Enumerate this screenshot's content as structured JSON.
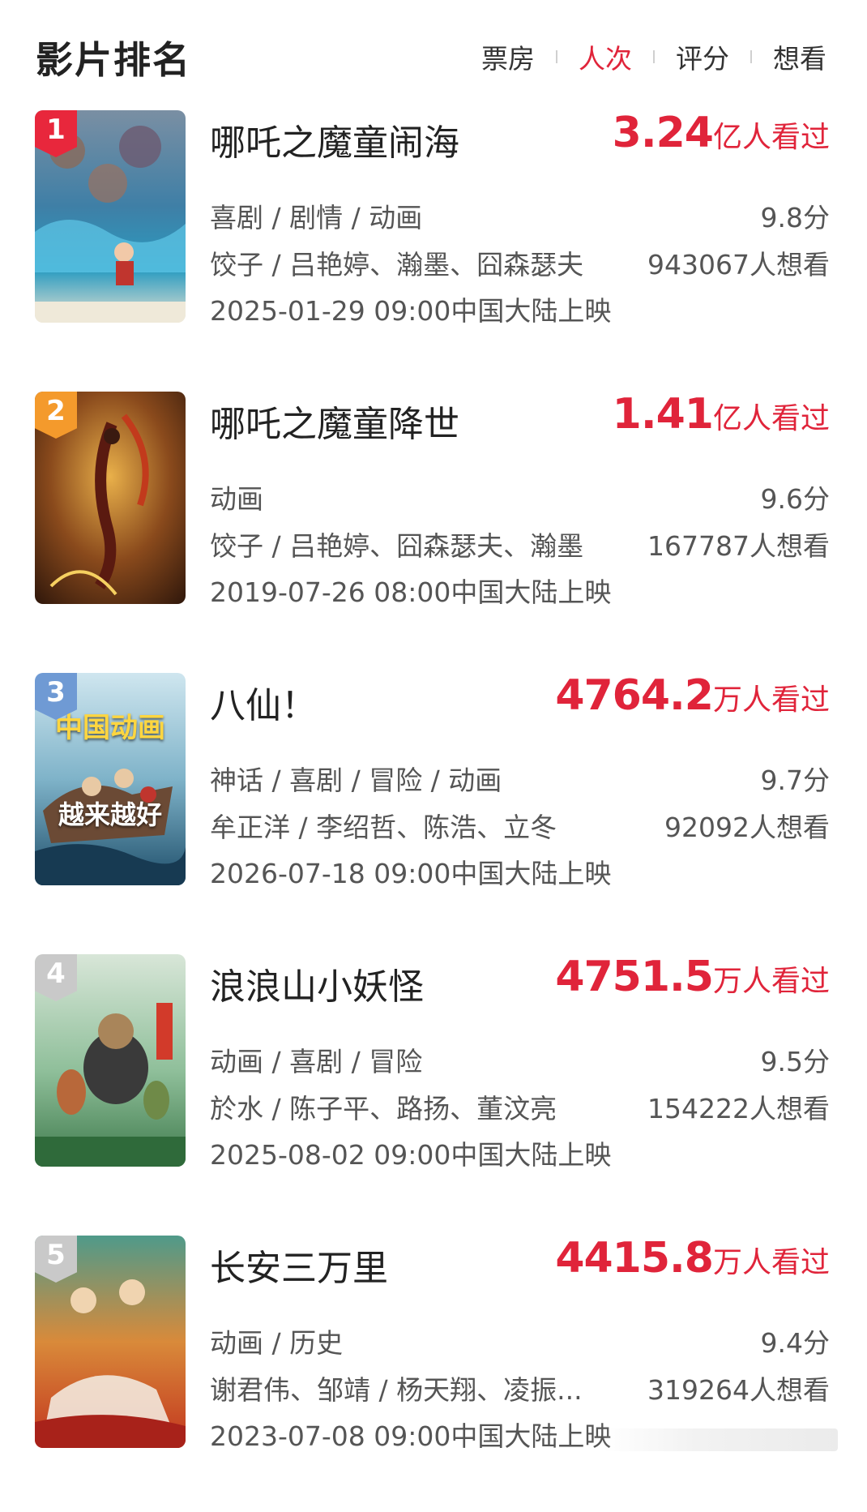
{
  "header": {
    "title": "影片排名",
    "tabs": [
      {
        "label": "票房",
        "active": false
      },
      {
        "label": "人次",
        "active": true
      },
      {
        "label": "评分",
        "active": false
      },
      {
        "label": "想看",
        "active": false
      }
    ]
  },
  "colors": {
    "accent": "#e0243a",
    "rank1": "#e8273c",
    "rank2": "#f49a2c",
    "rank3": "#6f9ad4",
    "rank_other": "#c9c9c9"
  },
  "movies": [
    {
      "rank": "1",
      "title": "哪吒之魔童闹海",
      "views_num": "3.24",
      "views_unit": "亿人看过",
      "genres": "喜剧 / 剧情 / 动画",
      "rating": "9.8分",
      "people": "饺子 / 吕艳婷、瀚墨、囧森瑟夫",
      "wants": "943067人想看",
      "release": "2025-01-29 09:00中国大陆上映",
      "poster_icon": "nezha-poster-image"
    },
    {
      "rank": "2",
      "title": "哪吒之魔童降世",
      "views_num": "1.41",
      "views_unit": "亿人看过",
      "genres": "动画",
      "rating": "9.6分",
      "people": "饺子 / 吕艳婷、囧森瑟夫、瀚墨",
      "wants": "167787人想看",
      "release": "2019-07-26 08:00中国大陆上映",
      "poster_icon": "nezha-poster-image"
    },
    {
      "rank": "3",
      "title": "八仙！",
      "views_num": "4764.2",
      "views_unit": "万人看过",
      "genres": "神话 / 喜剧 / 冒险 / 动画",
      "rating": "9.7分",
      "people": "牟正洋 / 李绍哲、陈浩、立冬",
      "wants": "92092人想看",
      "release": "2026-07-18 09:00中国大陆上映",
      "poster_text_1": "中国动画",
      "poster_text_2": "越来越好",
      "poster_icon": "baxian-poster-image"
    },
    {
      "rank": "4",
      "title": "浪浪山小妖怪",
      "views_num": "4751.5",
      "views_unit": "万人看过",
      "genres": "动画 / 喜剧 / 冒险",
      "rating": "9.5分",
      "people": "於水 / 陈子平、路扬、董汶亮",
      "wants": "154222人想看",
      "release": "2025-08-02 09:00中国大陆上映",
      "poster_icon": "langlangshan-poster-image"
    },
    {
      "rank": "5",
      "title": "长安三万里",
      "views_num": "4415.8",
      "views_unit": "万人看过",
      "genres": "动画 / 历史",
      "rating": "9.4分",
      "people": "谢君伟、邹靖 / 杨天翔、凌振...",
      "wants": "319264人想看",
      "release": "2023-07-08 09:00中国大陆上映",
      "poster_icon": "changan-poster-image"
    }
  ]
}
